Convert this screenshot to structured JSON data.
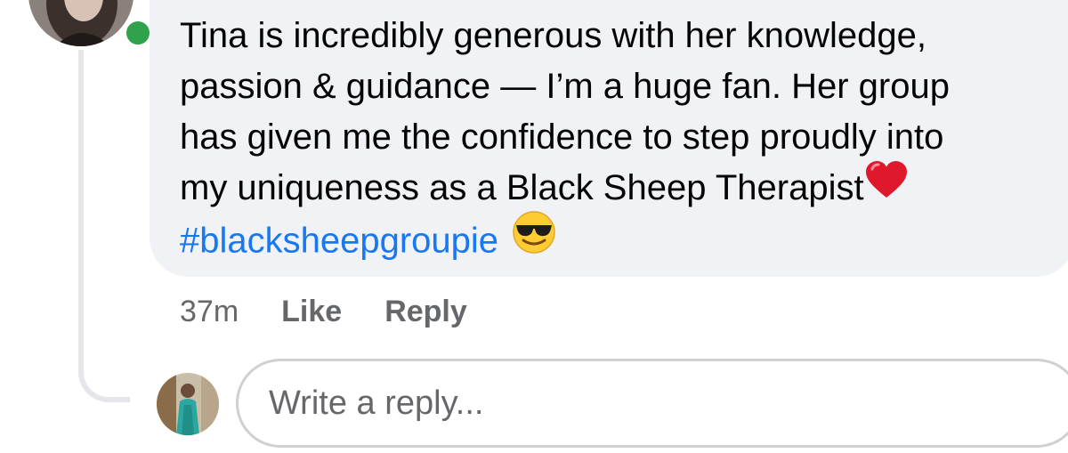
{
  "comment": {
    "lines": [
      "Tina is incredibly generous with her knowledge,",
      "passion & guidance — I’m a huge fan. Her group",
      "has given me the confidence to step proudly into",
      "my uniqueness as a Black Sheep Therapist"
    ],
    "hashtag": "#blacksheepgroupie",
    "emojis": [
      "red-heart-icon",
      "sunglasses-face-icon"
    ],
    "online_status_color": "#31a24c"
  },
  "meta": {
    "time": "37m",
    "like_label": "Like",
    "reply_label": "Reply"
  },
  "reply_box": {
    "placeholder": "Write a reply..."
  },
  "colors": {
    "bubble_background": "#f0f2f5",
    "hashtag": "#1877f2",
    "meta_text": "#65676b",
    "text": "#050505"
  }
}
